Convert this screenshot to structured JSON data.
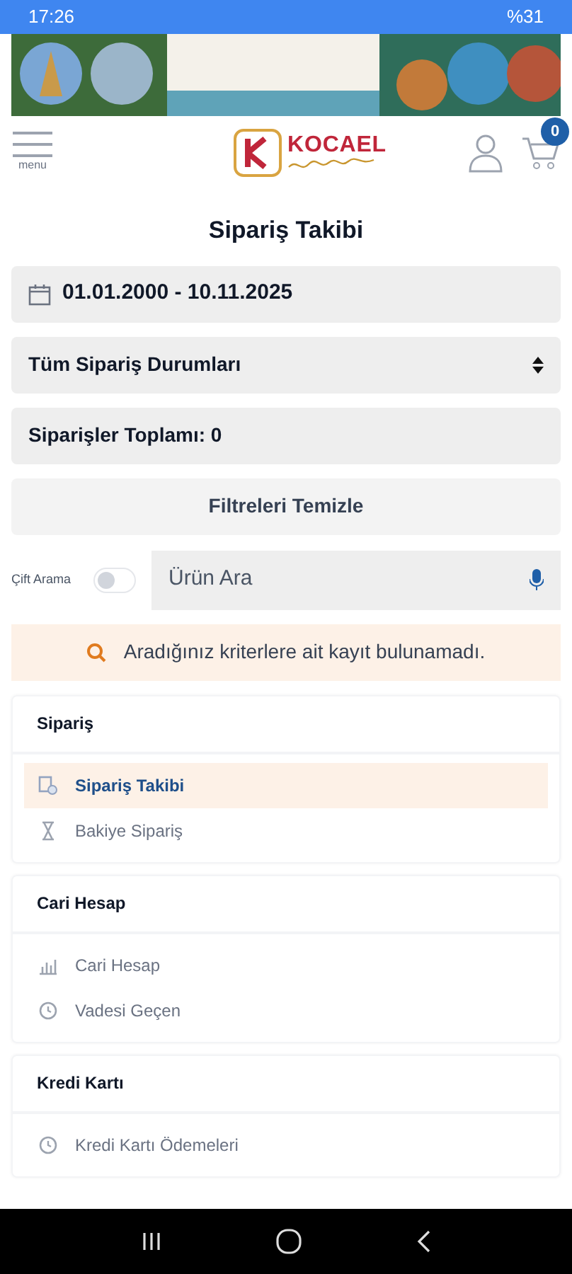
{
  "status_bar": {
    "time": "17:26",
    "battery": "%31"
  },
  "header": {
    "menu_label": "menu",
    "logo_text": "KOCAEL",
    "cart_count": "0"
  },
  "title": "Sipariş Takibi",
  "date_range": "01.01.2000 - 10.11.2025",
  "status_select": "Tüm Sipariş Durumları",
  "total": "Siparişler Toplamı: 0",
  "clear_button": "Filtreleri Temizle",
  "double_search": {
    "label": "Çift Arama",
    "on": false
  },
  "search": {
    "placeholder": "Ürün Ara"
  },
  "alert": "Aradığınız kriterlere ait kayıt bulunamadı.",
  "sections": [
    {
      "title": "Sipariş",
      "items": [
        {
          "label": "Sipariş Takibi",
          "kind": "doc",
          "selected": true
        },
        {
          "label": "Bakiye Sipariş",
          "kind": "hourglass",
          "selected": false
        }
      ]
    },
    {
      "title": "Cari Hesap",
      "items": [
        {
          "label": "Cari Hesap",
          "kind": "chart",
          "selected": false
        },
        {
          "label": "Vadesi Geçen",
          "kind": "clock",
          "selected": false
        }
      ]
    },
    {
      "title": "Kredi Kartı",
      "items": [
        {
          "label": "Kredi Kartı Ödemeleri",
          "kind": "clock",
          "selected": false
        }
      ]
    }
  ]
}
